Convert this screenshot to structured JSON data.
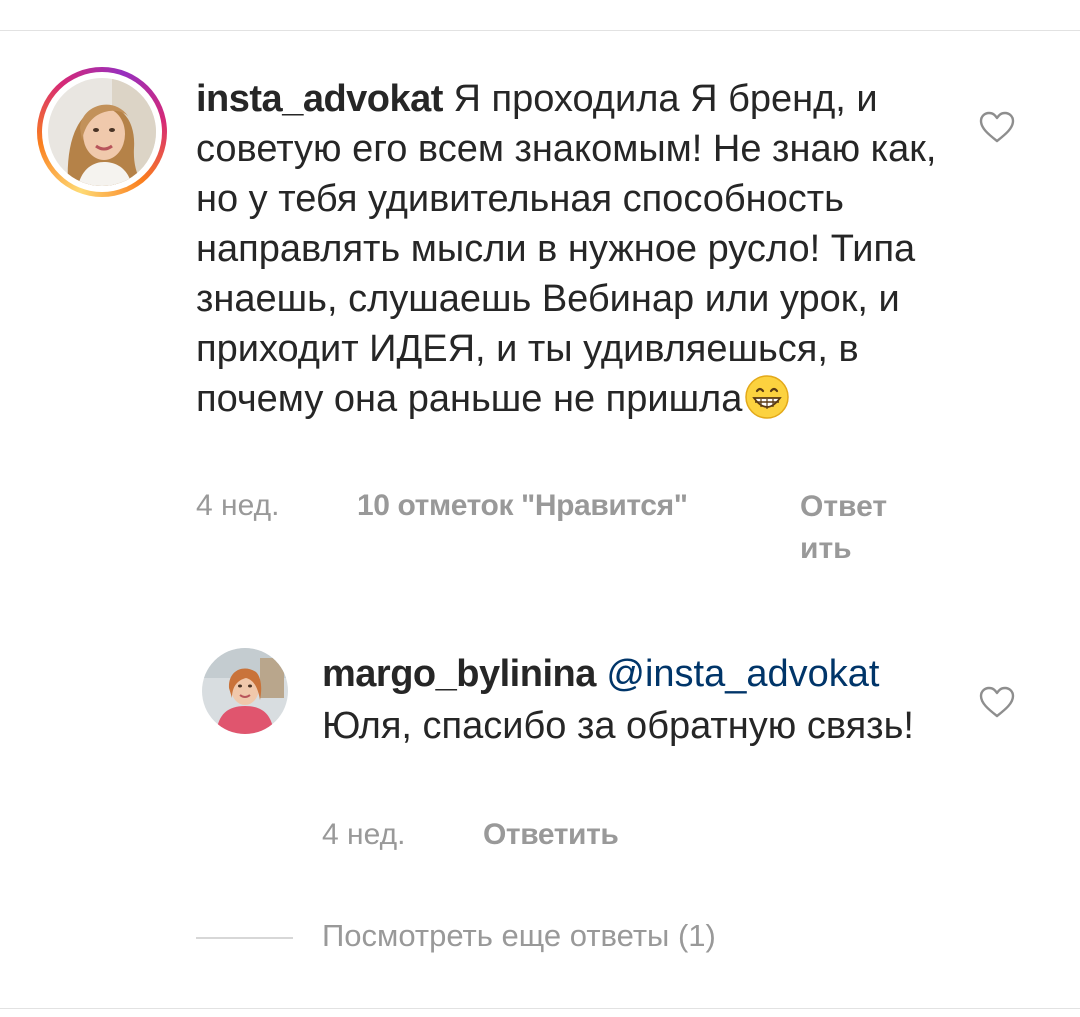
{
  "main_comment": {
    "username": "insta_advokat",
    "text": "Я проходила Я бренд, и советую его всем знакомым! Не знаю как, но у тебя удивительная способность направлять мысли в нужное русло! Типа знаешь, слушаешь Вебинар или урок, и приходит ИДЕЯ, и ты удивляешься, в почему она раньше не пришла",
    "emoji": "grinning-face-emoji",
    "time": "4 нед.",
    "likes": "10 отметок \"Нравится\"",
    "reply_label": "Ответить"
  },
  "reply_comment": {
    "username": "margo_bylinina",
    "mention": "@insta_advokat",
    "text": "Юля, спасибо за обратную связь!",
    "time": "4 нед.",
    "reply_label": "Ответить"
  },
  "view_more": {
    "label": "Посмотреть еще ответы (1)"
  },
  "icons": {
    "like": "heart-outline-icon",
    "story_ring": "story-ring-gradient"
  },
  "colors": {
    "text": "#262626",
    "secondary": "#999999",
    "mention": "#003569",
    "divider": "#e2e2e2"
  }
}
